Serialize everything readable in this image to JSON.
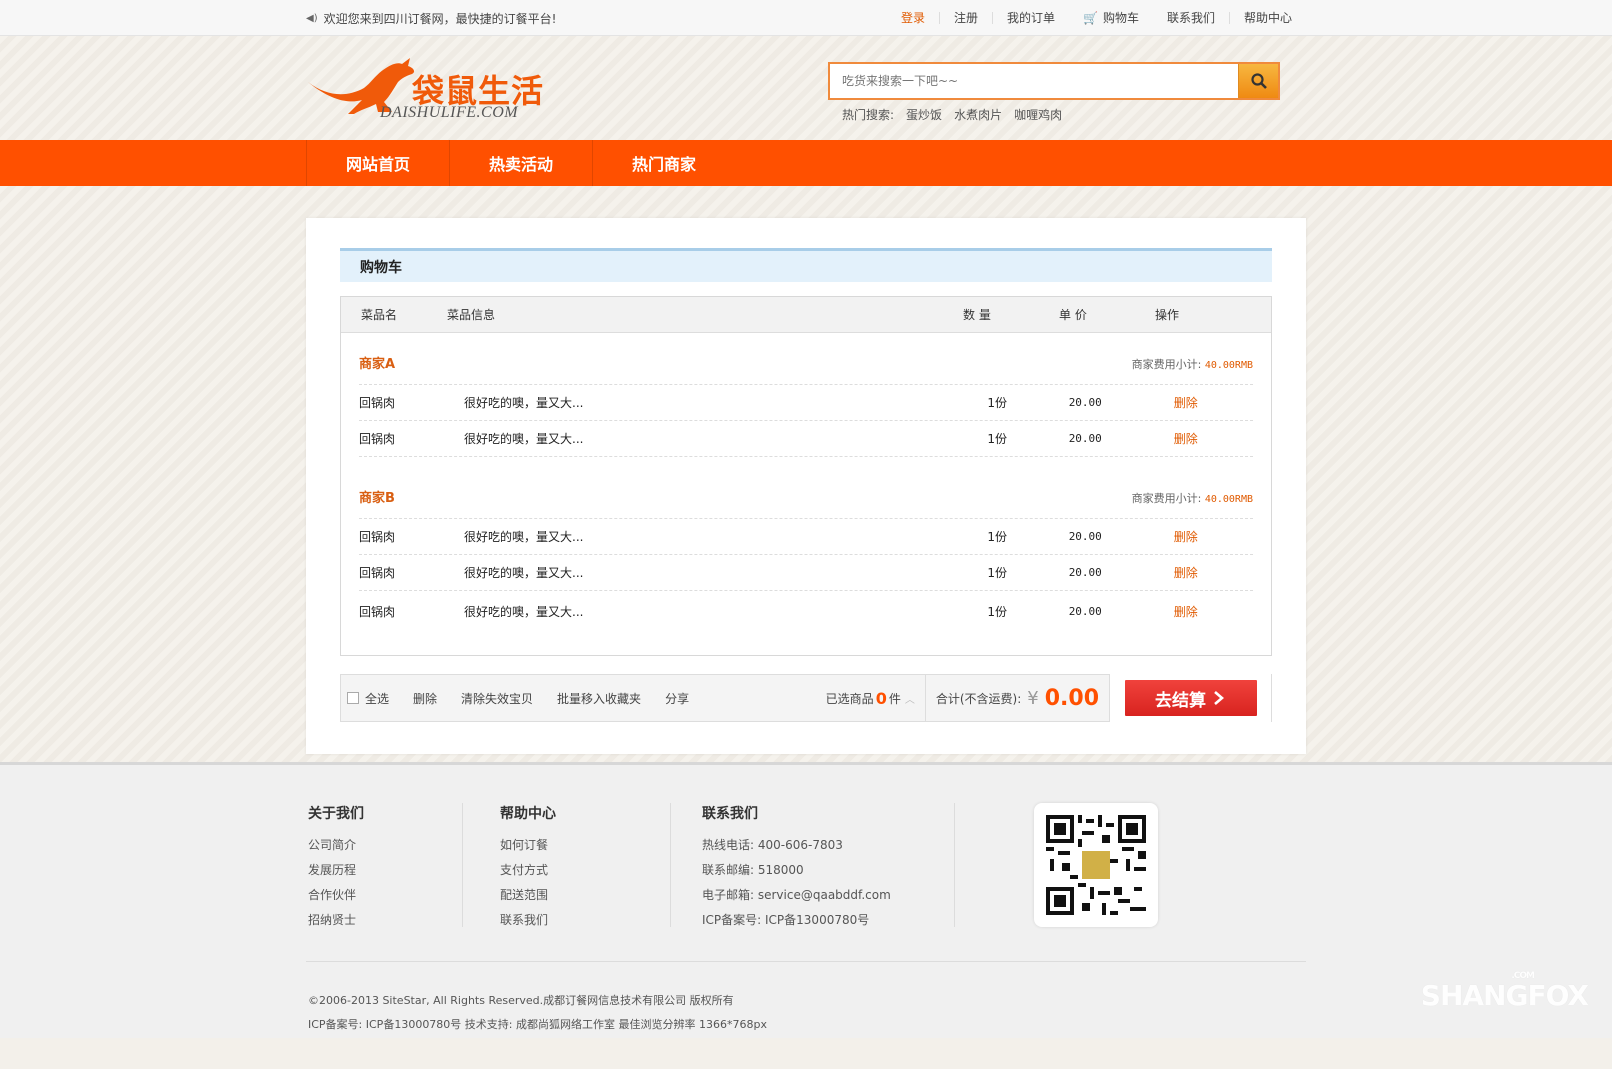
{
  "topbar": {
    "welcome": "欢迎您来到四川订餐网，最快捷的订餐平台!",
    "links": [
      "登录",
      "注册",
      "我的订单",
      "购物车",
      "联系我们",
      "帮助中心"
    ]
  },
  "logo": {
    "cn": "袋鼠生活",
    "en": "DAISHULIFE.COM"
  },
  "search": {
    "placeholder": "吃货来搜索一下吧~~",
    "hot_label": "热门搜索:",
    "hot_terms": [
      "蛋炒饭",
      "水煮肉片",
      "咖喱鸡肉"
    ]
  },
  "nav": [
    "网站首页",
    "热卖活动",
    "热门商家"
  ],
  "cart": {
    "title": "购物车",
    "headers": {
      "name": "菜品名",
      "info": "菜品信息",
      "qty": "数 量",
      "price": "单 价",
      "op": "操作"
    },
    "shops": [
      {
        "name": "商家A",
        "subtotal_label": "商家费用小计:",
        "subtotal": "40.00RMB",
        "items": [
          {
            "name": "回锅肉",
            "info": "很好吃的噢，量又大...",
            "qty": "1份",
            "price": "20.00",
            "op": "删除"
          },
          {
            "name": "回锅肉",
            "info": "很好吃的噢，量又大...",
            "qty": "1份",
            "price": "20.00",
            "op": "删除"
          }
        ]
      },
      {
        "name": "商家B",
        "subtotal_label": "商家费用小计:",
        "subtotal": "40.00RMB",
        "items": [
          {
            "name": "回锅肉",
            "info": "很好吃的噢，量又大...",
            "qty": "1份",
            "price": "20.00",
            "op": "删除"
          },
          {
            "name": "回锅肉",
            "info": "很好吃的噢，量又大...",
            "qty": "1份",
            "price": "20.00",
            "op": "删除"
          },
          {
            "name": "回锅肉",
            "info": "很好吃的噢，量又大...",
            "qty": "1份",
            "price": "20.00",
            "op": "删除"
          }
        ]
      }
    ],
    "footer": {
      "select_all": "全选",
      "delete": "删除",
      "clear_invalid": "清除失效宝贝",
      "batch_fav": "批量移入收藏夹",
      "share": "分享",
      "selected_label": "已选商品",
      "selected_count": "0",
      "selected_unit": "件",
      "total_label": "合计(不含运费):",
      "currency": "¥",
      "total": "0.00",
      "checkout": "去结算"
    }
  },
  "footer": {
    "about": {
      "title": "关于我们",
      "items": [
        "公司简介",
        "发展历程",
        "合作伙伴",
        "招纳贤士"
      ]
    },
    "help": {
      "title": "帮助中心",
      "items": [
        "如何订餐",
        "支付方式",
        "配送范围",
        "联系我们"
      ]
    },
    "contact": {
      "title": "联系我们",
      "items": [
        "热线电话: 400-606-7803",
        "联系邮编: 518000",
        "电子邮箱: service@qaabddf.com",
        "ICP备案号: ICP备13000780号"
      ]
    },
    "copyright": "©2006-2013 SiteStar, All Rights Reserved.成都订餐网信息技术有限公司 版权所有",
    "icp_line": "ICP备案号: ICP备13000780号   技术支持: 成都尚狐网络工作室   最佳浏览分辨率 1366*768px"
  },
  "brand": {
    "name": "SHANGFOX",
    "suffix": ".COM"
  },
  "colors": {
    "accent": "#ff5000",
    "checkout": "#d8231f",
    "link_orange": "#e05a00"
  }
}
